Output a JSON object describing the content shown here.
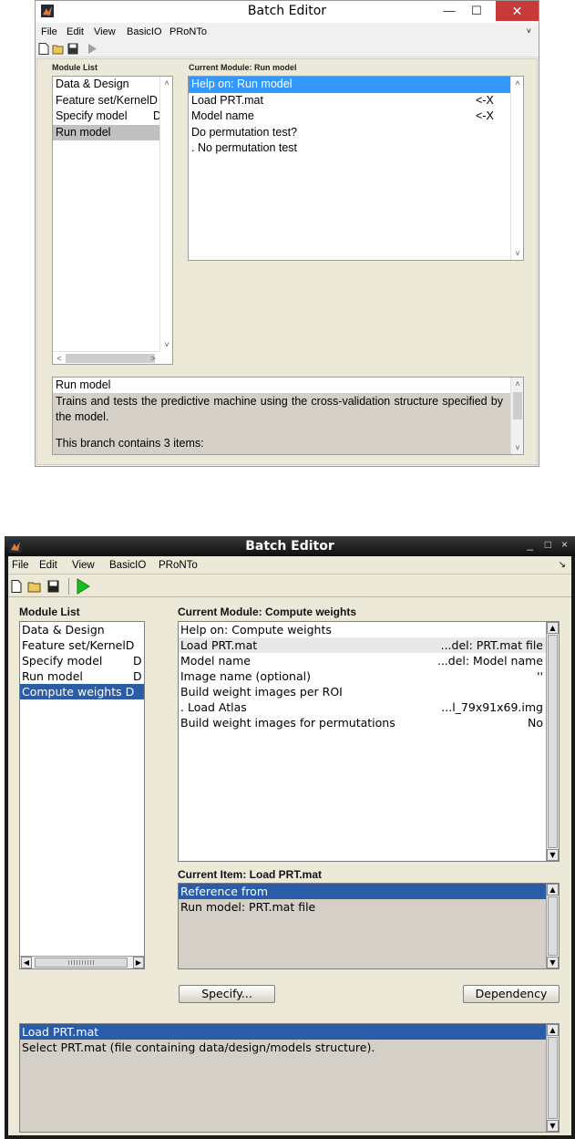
{
  "window1": {
    "title": "Batch Editor",
    "minimize": "—",
    "maximize": "☐",
    "close": "✕",
    "menu": [
      "File",
      "Edit",
      "View",
      "BasicIO",
      "PRoNTo"
    ],
    "menu_arrow": "˅",
    "module_list_label": "Module List",
    "modules": [
      "Data & Design",
      "Feature set/KernelD",
      "Specify model",
      "Run model"
    ],
    "module_suffix": "D",
    "current_module_label": "Current Module: Run model",
    "items": [
      {
        "label": "Help on: Run model",
        "value": ""
      },
      {
        "label": "Load PRT.mat",
        "value": "<-X"
      },
      {
        "label": "Model name",
        "value": "<-X"
      },
      {
        "label": "Do permutation test?",
        "value": ""
      },
      {
        "label": ". No permutation test",
        "value": ""
      }
    ],
    "help_title": "Run model",
    "help_text": "Trains and tests the predictive machine using the cross-validation structure specified by the model.",
    "help_more": "This branch contains 3 items:"
  },
  "window2": {
    "title": "Batch Editor",
    "minimize": "_",
    "maximize": "□",
    "close": "×",
    "menu": [
      "File",
      "Edit",
      "View",
      "BasicIO",
      "PRoNTo"
    ],
    "menu_arrow": "↘",
    "module_list_label": "Module List",
    "modules": [
      "Data & Design",
      "Feature set/KernelD",
      "Specify model",
      "Run model",
      "Compute weights D"
    ],
    "module_suffix": "D",
    "current_module_label": "Current Module: Compute weights",
    "items": [
      {
        "label": "Help on: Compute weights",
        "value": ""
      },
      {
        "label": "Load PRT.mat",
        "value": "...del: PRT.mat file"
      },
      {
        "label": "Model name",
        "value": "...del: Model name"
      },
      {
        "label": "Image name (optional)",
        "value": "''"
      },
      {
        "label": "Build weight images per ROI",
        "value": ""
      },
      {
        "label": ". Load Atlas",
        "value": "...l_79x91x69.img"
      },
      {
        "label": "Build weight images for permutations",
        "value": "No"
      }
    ],
    "current_item_label": "Current Item: Load PRT.mat",
    "current_item_rows": [
      "Reference from",
      "Run model: PRT.mat file"
    ],
    "specify_button": "Specify...",
    "dependency_button": "Dependency",
    "help_title": "Load PRT.mat",
    "help_text": "Select PRT.mat (file containing data/design/models structure)."
  },
  "colors": {
    "panel_bg": "#ece9d8",
    "selection_blue": "#2b5ca8",
    "win7_selection": "#3399ff",
    "close_red": "#c73a3a"
  }
}
